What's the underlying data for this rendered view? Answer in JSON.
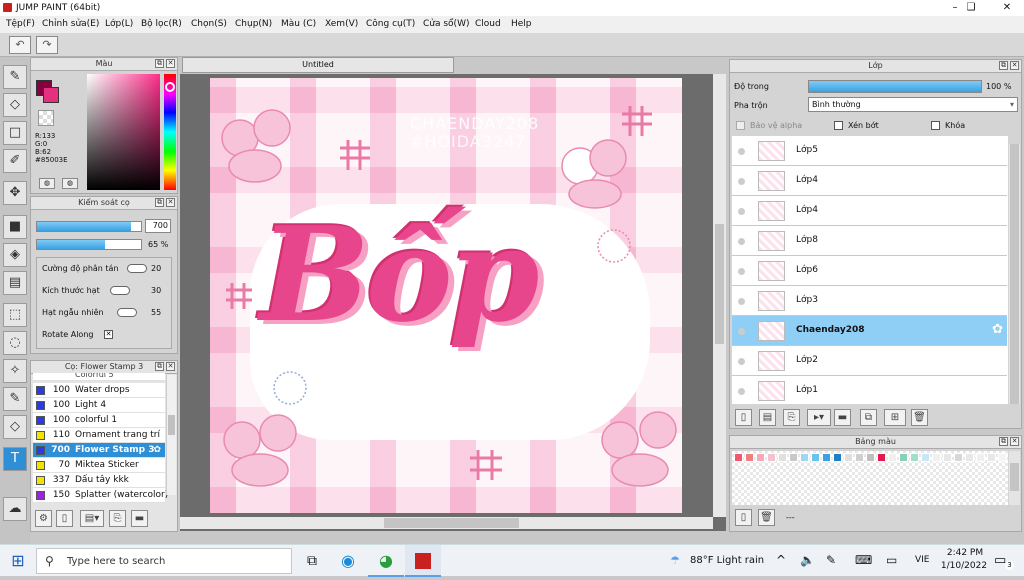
{
  "window": {
    "title": "JUMP PAINT (64bit)",
    "minimize": "–",
    "maximize": "❑",
    "close": "✕"
  },
  "menu": [
    "Tệp(F)",
    "Chỉnh sửa(E)",
    "Lớp(L)",
    "Bộ lọc(R)",
    "Chọn(S)",
    "Chụp(N)",
    "Màu (C)",
    "Xem(V)",
    "Công cụ(T)",
    "Cửa sổ(W)",
    "Cloud",
    "Help"
  ],
  "toolbar": {
    "undo_icon": "↶",
    "redo_icon": "↷"
  },
  "color_panel": {
    "title": "Màu",
    "r": "R:133",
    "g": "G:0",
    "b": "B:62",
    "hex": "#85003E",
    "main_color": "#85003e",
    "sub_color": "#e5307f"
  },
  "brush_control": {
    "title": "Kiểm soát cọ",
    "size": "700",
    "size_fill": 0.9,
    "opacity": "65 %",
    "opacity_fill": 0.65,
    "params": [
      {
        "label": "Cường độ phân tán",
        "value": "20"
      },
      {
        "label": "Kích thước hạt",
        "value": "30"
      },
      {
        "label": "Hạt ngẫu nhiên",
        "value": "55"
      }
    ],
    "rotate_along": "Rotate Along"
  },
  "brush_list": {
    "title": "Cọ: Flower Stamp 3",
    "top_partial": "Colorful 5",
    "items": [
      {
        "num": "100",
        "name": "Water drops",
        "color": "#2a3be0"
      },
      {
        "num": "100",
        "name": "Light 4",
        "color": "#2a3be0"
      },
      {
        "num": "100",
        "name": "colorful 1",
        "color": "#2a3be0"
      },
      {
        "num": "110",
        "name": "Ornament trang trí",
        "color": "#f0e400"
      },
      {
        "num": "700",
        "name": "Flower Stamp 3",
        "color": "#2a3be0"
      },
      {
        "num": "70",
        "name": "Miktea Sticker",
        "color": "#f0e400"
      },
      {
        "num": "337",
        "name": "Dấu tây kkk",
        "color": "#f0e400"
      },
      {
        "num": "150",
        "name": "Splatter (watercolor)",
        "color": "#a020e0"
      }
    ],
    "selected_index": 4
  },
  "canvas": {
    "tab": "Untitled",
    "watermark1": "CHAENDAY208",
    "watermark2": "#HOIDA3247",
    "lettering": "Bốp"
  },
  "layers_panel": {
    "title": "Lớp",
    "opacity_label": "Độ trong",
    "opacity_value": "100 %",
    "opacity_fill": 1.0,
    "blend_label": "Pha trộn",
    "blend_value": "Bình thường",
    "protect_alpha": "Bảo vệ alpha",
    "clip": "Xén bớt",
    "lock": "Khóa",
    "layers": [
      "Lớp5",
      "Lớp4",
      "Lớp4",
      "Lớp8",
      "Lớp6",
      "Lớp3",
      "Chaenday208",
      "Lớp2",
      "Lớp1"
    ],
    "selected_index": 6
  },
  "swatch_panel": {
    "title": "Bảng màu",
    "footer": "---",
    "swatches": [
      "#f05a70",
      "#f08080",
      "#f6a9b8",
      "#f1c4d0",
      "#e0e0e0",
      "#c9c9c9",
      "#9fd6f0",
      "#68c2ec",
      "#3aa2e2",
      "#1f7fc2",
      "#e0e0e0",
      "#d0d0d0",
      "#bfbfbf",
      "#e01a4f",
      "#f0f0f0",
      "#8ad0b8",
      "#a0e0c8",
      "#c8e8f8",
      "#f0f0f0",
      "#e8e8e8",
      "#d8d8d8",
      "#e8e8e8",
      "#f0f0f0",
      "#e8e8e8",
      "#f4f4f4"
    ]
  },
  "taskbar": {
    "search_placeholder": "Type here to search",
    "weather": "88°F  Light rain",
    "lang": "VIE",
    "time": "2:42 PM",
    "date": "1/10/2022",
    "notif_count": "3"
  }
}
